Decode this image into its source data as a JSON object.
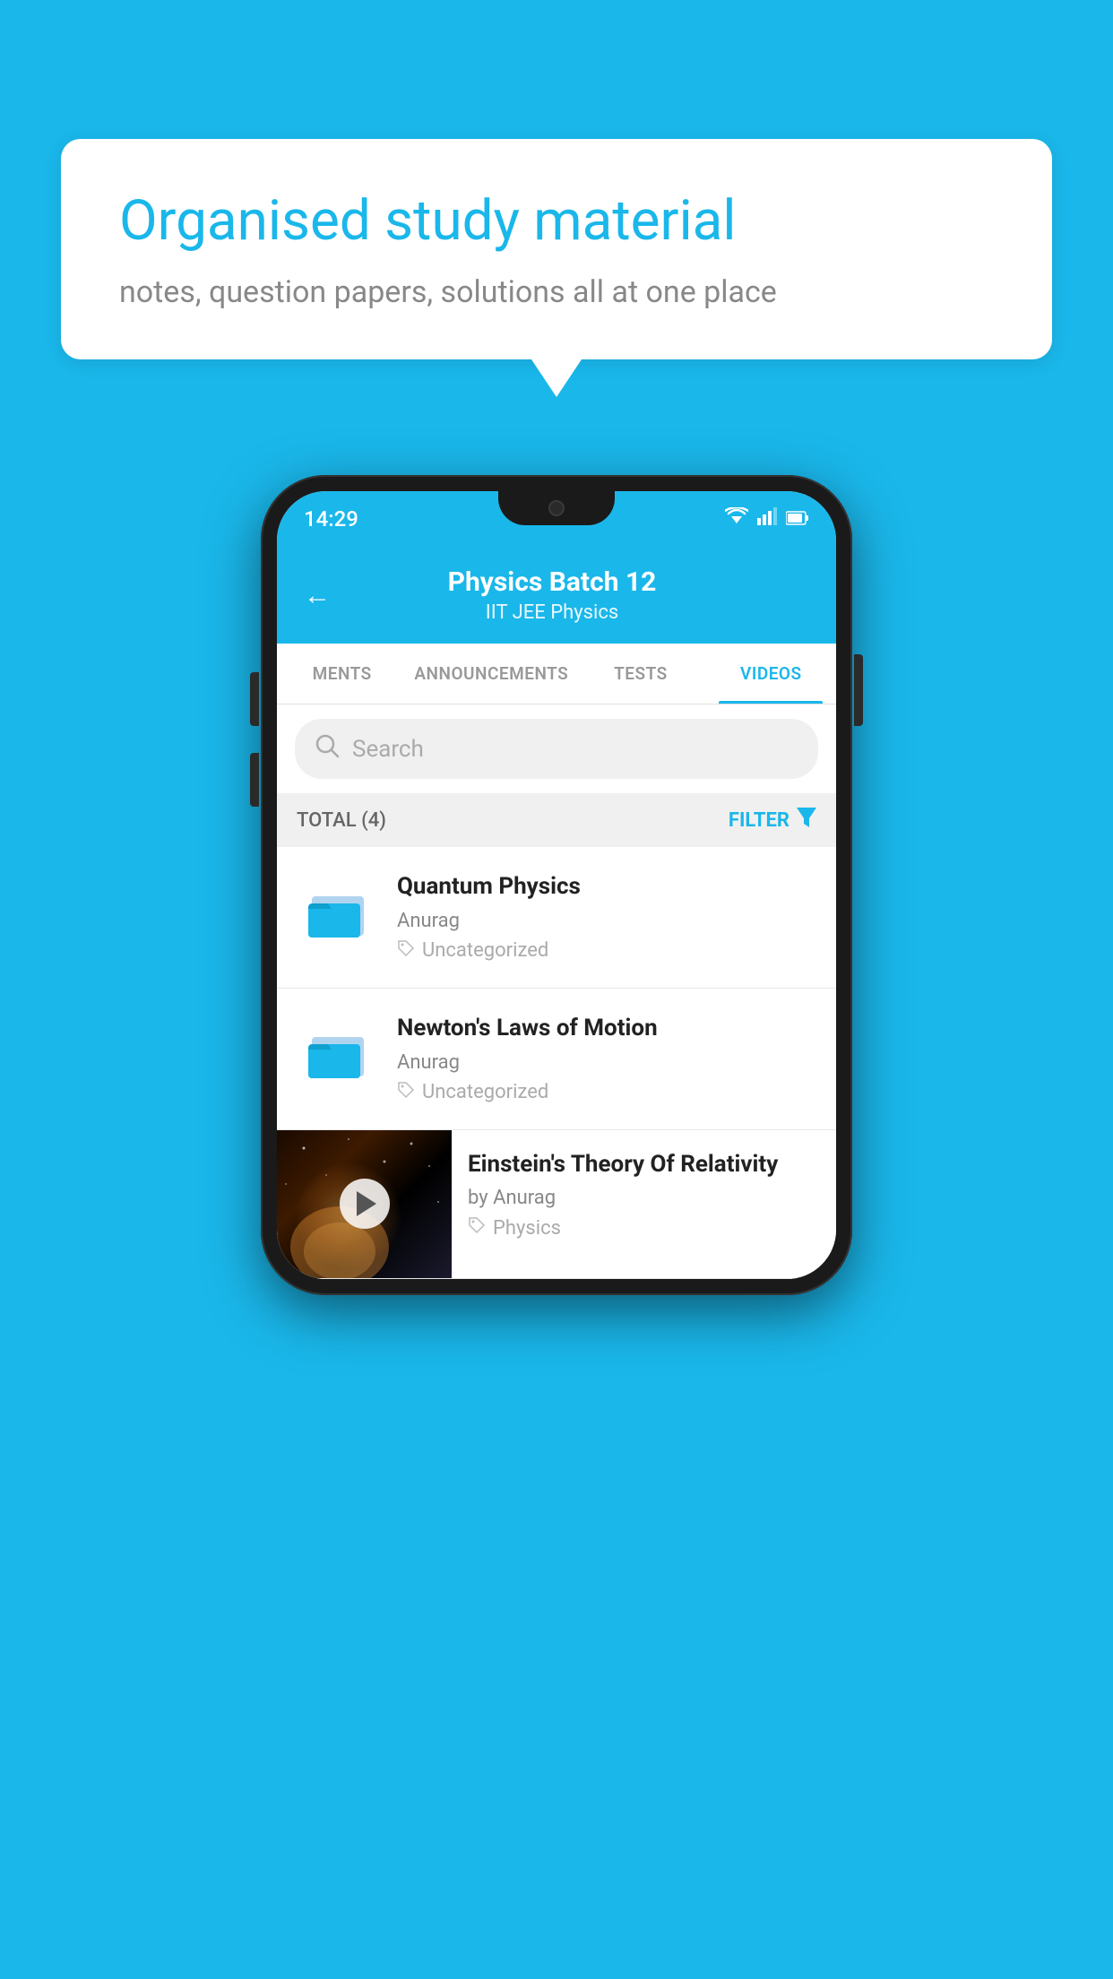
{
  "page": {
    "background_color": "#1ab7ea"
  },
  "speech_bubble": {
    "title": "Organised study material",
    "subtitle": "notes, question papers, solutions all at one place"
  },
  "status_bar": {
    "time": "14:29",
    "wifi": "▼",
    "signal": "▲",
    "battery": "▮"
  },
  "app_header": {
    "back_label": "←",
    "title": "Physics Batch 12",
    "subtitle": "IIT JEE   Physics"
  },
  "tabs": [
    {
      "label": "MENTS",
      "active": false
    },
    {
      "label": "ANNOUNCEMENTS",
      "active": false
    },
    {
      "label": "TESTS",
      "active": false
    },
    {
      "label": "VIDEOS",
      "active": true
    }
  ],
  "search": {
    "placeholder": "Search"
  },
  "filter_bar": {
    "total_label": "TOTAL (4)",
    "filter_label": "FILTER"
  },
  "video_items": [
    {
      "id": 1,
      "title": "Quantum Physics",
      "author": "Anurag",
      "tag": "Uncategorized",
      "type": "folder",
      "has_thumbnail": false
    },
    {
      "id": 2,
      "title": "Newton's Laws of Motion",
      "author": "Anurag",
      "tag": "Uncategorized",
      "type": "folder",
      "has_thumbnail": false
    },
    {
      "id": 3,
      "title": "Einstein's Theory Of Relativity",
      "author": "by Anurag",
      "tag": "Physics",
      "type": "video",
      "has_thumbnail": true
    }
  ]
}
